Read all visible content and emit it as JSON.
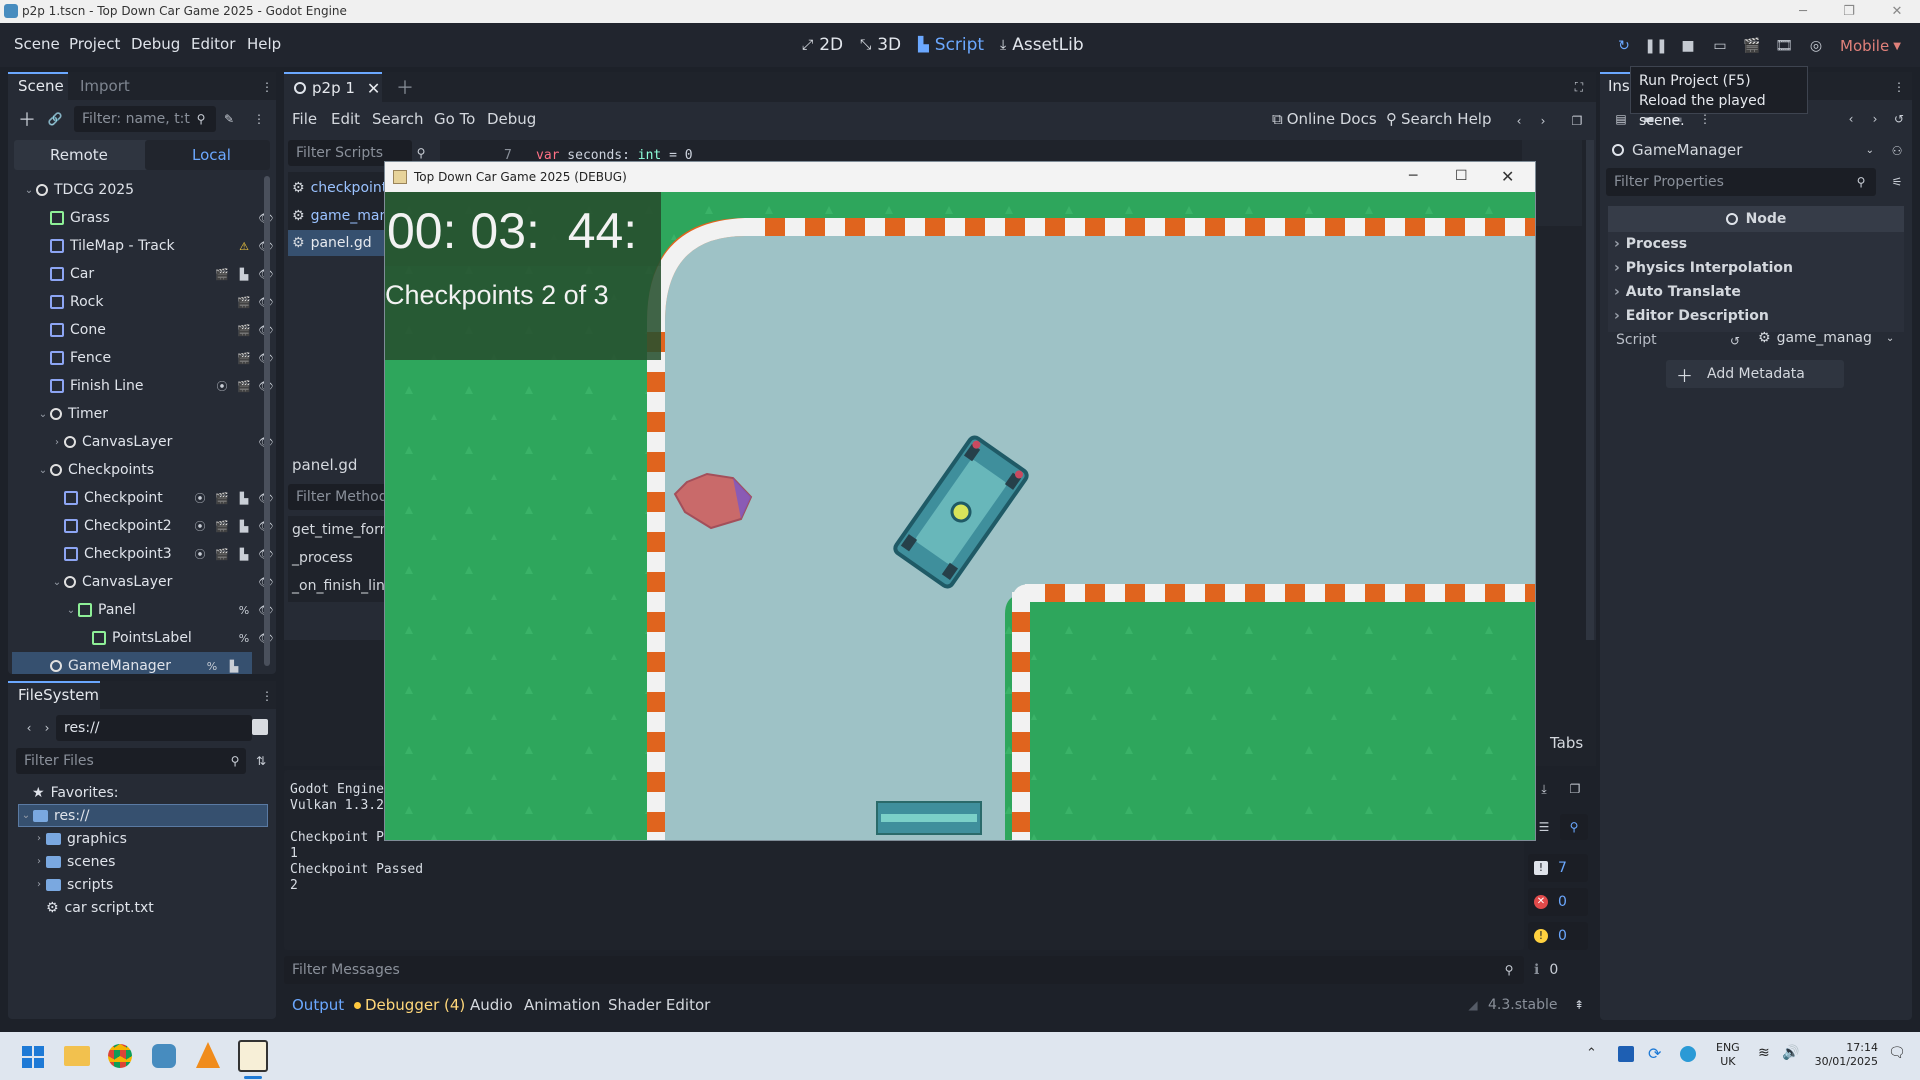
{
  "window": {
    "title": "p2p 1.tscn - Top Down Car Game 2025 - Godot Engine"
  },
  "menu": [
    "Scene",
    "Project",
    "Debug",
    "Editor",
    "Help"
  ],
  "workspaces": [
    {
      "label": "2D",
      "icon": "2d-icon"
    },
    {
      "label": "3D",
      "icon": "3d-icon"
    },
    {
      "label": "Script",
      "icon": "script-icon",
      "active": true
    },
    {
      "label": "AssetLib",
      "icon": "assetlib-icon"
    }
  ],
  "renderer": "Mobile",
  "tooltip": {
    "line1": "Run Project (F5)",
    "line2": "Reload the played scene."
  },
  "scene_dock": {
    "tabs": [
      "Scene",
      "Import"
    ],
    "filter_placeholder": "Filter: name, t:t",
    "modes": [
      "Remote",
      "Local"
    ],
    "nodes": [
      {
        "name": "TDCG 2025",
        "depth": 0,
        "expanded": true,
        "color": "#e0e0e0",
        "badges": []
      },
      {
        "name": "Grass",
        "depth": 1,
        "color": "#8eef97",
        "badges": [
          "eye"
        ]
      },
      {
        "name": "TileMap - Track",
        "depth": 1,
        "color": "#8da5f3",
        "badges": [
          "warn",
          "eye"
        ]
      },
      {
        "name": "Car",
        "depth": 1,
        "color": "#8da5f3",
        "badges": [
          "clap",
          "script",
          "eye"
        ]
      },
      {
        "name": "Rock",
        "depth": 1,
        "color": "#8da5f3",
        "badges": [
          "clap",
          "eye"
        ]
      },
      {
        "name": "Cone",
        "depth": 1,
        "color": "#8da5f3",
        "badges": [
          "clap",
          "eye"
        ]
      },
      {
        "name": "Fence",
        "depth": 1,
        "color": "#8da5f3",
        "badges": [
          "clap",
          "eye"
        ]
      },
      {
        "name": "Finish Line",
        "depth": 1,
        "color": "#8da5f3",
        "badges": [
          "signal",
          "clap",
          "eye"
        ]
      },
      {
        "name": "Timer",
        "depth": 1,
        "expanded": true,
        "color": "#e0e0e0",
        "badges": []
      },
      {
        "name": "CanvasLayer",
        "depth": 2,
        "collapsed": true,
        "color": "#e0e0e0",
        "badges": [
          "eye"
        ]
      },
      {
        "name": "Checkpoints",
        "depth": 1,
        "expanded": true,
        "color": "#e0e0e0",
        "badges": []
      },
      {
        "name": "Checkpoint",
        "depth": 2,
        "color": "#8da5f3",
        "badges": [
          "signal",
          "clap",
          "script",
          "eye"
        ]
      },
      {
        "name": "Checkpoint2",
        "depth": 2,
        "color": "#8da5f3",
        "badges": [
          "signal",
          "clap",
          "script",
          "eye"
        ]
      },
      {
        "name": "Checkpoint3",
        "depth": 2,
        "color": "#8da5f3",
        "badges": [
          "signal",
          "clap",
          "script",
          "eye"
        ]
      },
      {
        "name": "CanvasLayer",
        "depth": 2,
        "expanded": true,
        "color": "#e0e0e0",
        "badges": [
          "eye"
        ]
      },
      {
        "name": "Panel",
        "depth": 3,
        "expanded": true,
        "color": "#8eef97",
        "badges": [
          "pct",
          "eye"
        ]
      },
      {
        "name": "PointsLabel",
        "depth": 4,
        "color": "#8eef97",
        "badges": [
          "pct",
          "eye"
        ]
      },
      {
        "name": "GameManager",
        "depth": 1,
        "selected": true,
        "color": "#e0e0e0",
        "badges": [
          "pct",
          "script"
        ]
      }
    ]
  },
  "filesystem": {
    "tab": "FileSystem",
    "path": "res://",
    "filter_placeholder": "Filter Files",
    "items": [
      {
        "name": "Favorites:",
        "depth": 0,
        "icon": "star"
      },
      {
        "name": "res://",
        "depth": 0,
        "icon": "folder",
        "selected": true
      },
      {
        "name": "graphics",
        "depth": 1,
        "icon": "folder"
      },
      {
        "name": "scenes",
        "depth": 1,
        "icon": "folder"
      },
      {
        "name": "scripts",
        "depth": 1,
        "icon": "folder"
      },
      {
        "name": "car script.txt",
        "depth": 1,
        "icon": "file"
      }
    ]
  },
  "script_editor": {
    "tab": "p2p 1",
    "menu": [
      "File",
      "Edit",
      "Search",
      "Go To",
      "Debug"
    ],
    "online_docs": "Online Docs",
    "search_help": "Search Help",
    "filter_scripts": "Filter Scripts",
    "scripts": [
      "checkpoint",
      "game_man",
      "panel.gd"
    ],
    "current_script": "panel.gd",
    "filter_methods": "Filter Methods",
    "methods": [
      "get_time_form",
      "_process",
      "_on_finish_line"
    ],
    "code_line_no": "7",
    "code_line": {
      "kw": "var",
      "name": " seconds",
      "sep": ": ",
      "type": "int",
      "rest": " = 0"
    }
  },
  "output": {
    "lines": [
      "Godot Engine",
      "Vulkan 1.3.2",
      "",
      "Checkpoint Passed",
      "1",
      "Checkpoint Passed",
      "2"
    ],
    "filter_placeholder": "Filter Messages",
    "tabs_label": "Tabs",
    "counts": {
      "messages": "7",
      "errors": "0",
      "warnings": "0",
      "info": "0"
    }
  },
  "bottom_tabs": [
    "Output",
    "Debugger (4)",
    "Audio",
    "Animation",
    "Shader Editor"
  ],
  "version": "4.3.stable",
  "inspector": {
    "tab": "Insp",
    "node_name": "GameManager",
    "filter_placeholder": "Filter Properties",
    "section": "Node",
    "groups": [
      "Process",
      "Physics Interpolation",
      "Auto Translate",
      "Editor Description"
    ],
    "script_label": "Script",
    "script_value": "game_manag",
    "add_metadata": "Add Metadata"
  },
  "game": {
    "title": "Top Down Car Game 2025 (DEBUG)",
    "timer": "00: 03:  44:",
    "checkpoints": "Checkpoints 2 of 3"
  },
  "taskbar": {
    "lang1": "ENG",
    "lang2": "UK",
    "time": "17:14",
    "date": "30/01/2025"
  },
  "colors": {
    "accent": "#6ba8ff",
    "grass": "#2ea65c",
    "track": "#9ec2c6",
    "curb_orange": "#e0641e"
  }
}
